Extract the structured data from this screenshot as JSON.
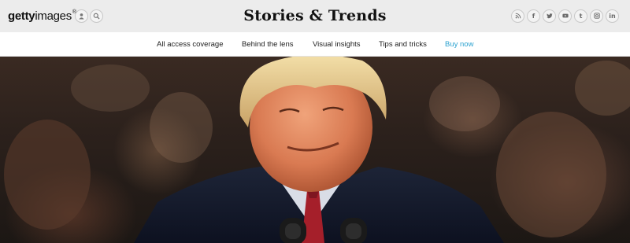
{
  "header": {
    "logo": {
      "bold": "getty",
      "light": "images",
      "mark": "®"
    },
    "title": "Stories & Trends",
    "left_buttons": [
      {
        "icon": "user-icon"
      },
      {
        "icon": "search-icon"
      }
    ],
    "social": [
      {
        "icon": "rss-icon",
        "glyph": ")"
      },
      {
        "icon": "facebook-icon",
        "glyph": "f"
      },
      {
        "icon": "twitter-icon",
        "glyph": "t"
      },
      {
        "icon": "youtube-icon",
        "glyph": "▶"
      },
      {
        "icon": "tumblr-icon",
        "glyph": "t"
      },
      {
        "icon": "instagram-icon",
        "glyph": "▣"
      },
      {
        "icon": "linkedin-icon",
        "glyph": "in"
      }
    ]
  },
  "nav": {
    "items": [
      {
        "label": "All access coverage"
      },
      {
        "label": "Behind the lens"
      },
      {
        "label": "Visual insights"
      },
      {
        "label": "Tips and tricks"
      },
      {
        "label": "Buy now"
      }
    ]
  },
  "colors": {
    "accent": "#2aa1cf",
    "topbar": "#ececec"
  }
}
